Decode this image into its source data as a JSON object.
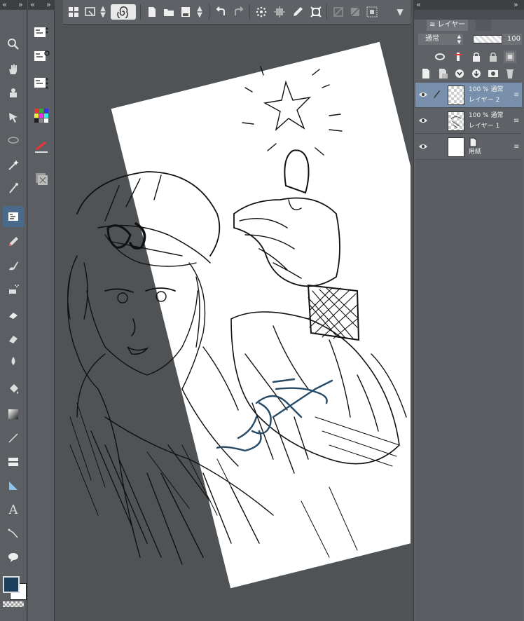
{
  "toolbar": {
    "buttons": [
      "layout-icon",
      "screen-capture-icon",
      "spiral-icon",
      "new-file-icon",
      "open-folder-icon",
      "save-icon",
      "undo-icon",
      "redo-icon",
      "fill-transform-icon",
      "expand-icon",
      "pen-icon",
      "crop-icon",
      "strikethrough-icon",
      "hatch-icon",
      "grid-icon",
      "dropdown-icon"
    ]
  },
  "tools": [
    "zoom-icon",
    "hand-icon",
    "rotate-icon",
    "move-icon",
    "lasso-icon",
    "magic-wand-icon",
    "eyedropper-icon",
    "pen-icon",
    "pencil-icon",
    "brush-icon",
    "airbrush-icon",
    "eraser-icon",
    "decorate-icon",
    "blend-icon",
    "fill-icon",
    "gradient-icon",
    "line-icon",
    "frame-icon",
    "ruler-icon",
    "text-icon",
    "balloon-icon",
    "correct-line-icon"
  ],
  "tools_text_label": "A",
  "colors": {
    "main": "#1b3f5c",
    "sub": "#ffffff",
    "accent": "#7890ab",
    "stroke_blue": "#274a66"
  },
  "layer_panel": {
    "tab_label": "レイヤー",
    "blend_mode": "通常",
    "opacity": "100",
    "layers": [
      {
        "line1": "100 % 通常",
        "line2": "レイヤー 2",
        "selected": true,
        "pen": true
      },
      {
        "line1": "100 % 通常",
        "line2": "レイヤー 1",
        "selected": false,
        "pen": false
      },
      {
        "line1": "",
        "line2": "用紙",
        "selected": false,
        "pen": false
      }
    ]
  }
}
